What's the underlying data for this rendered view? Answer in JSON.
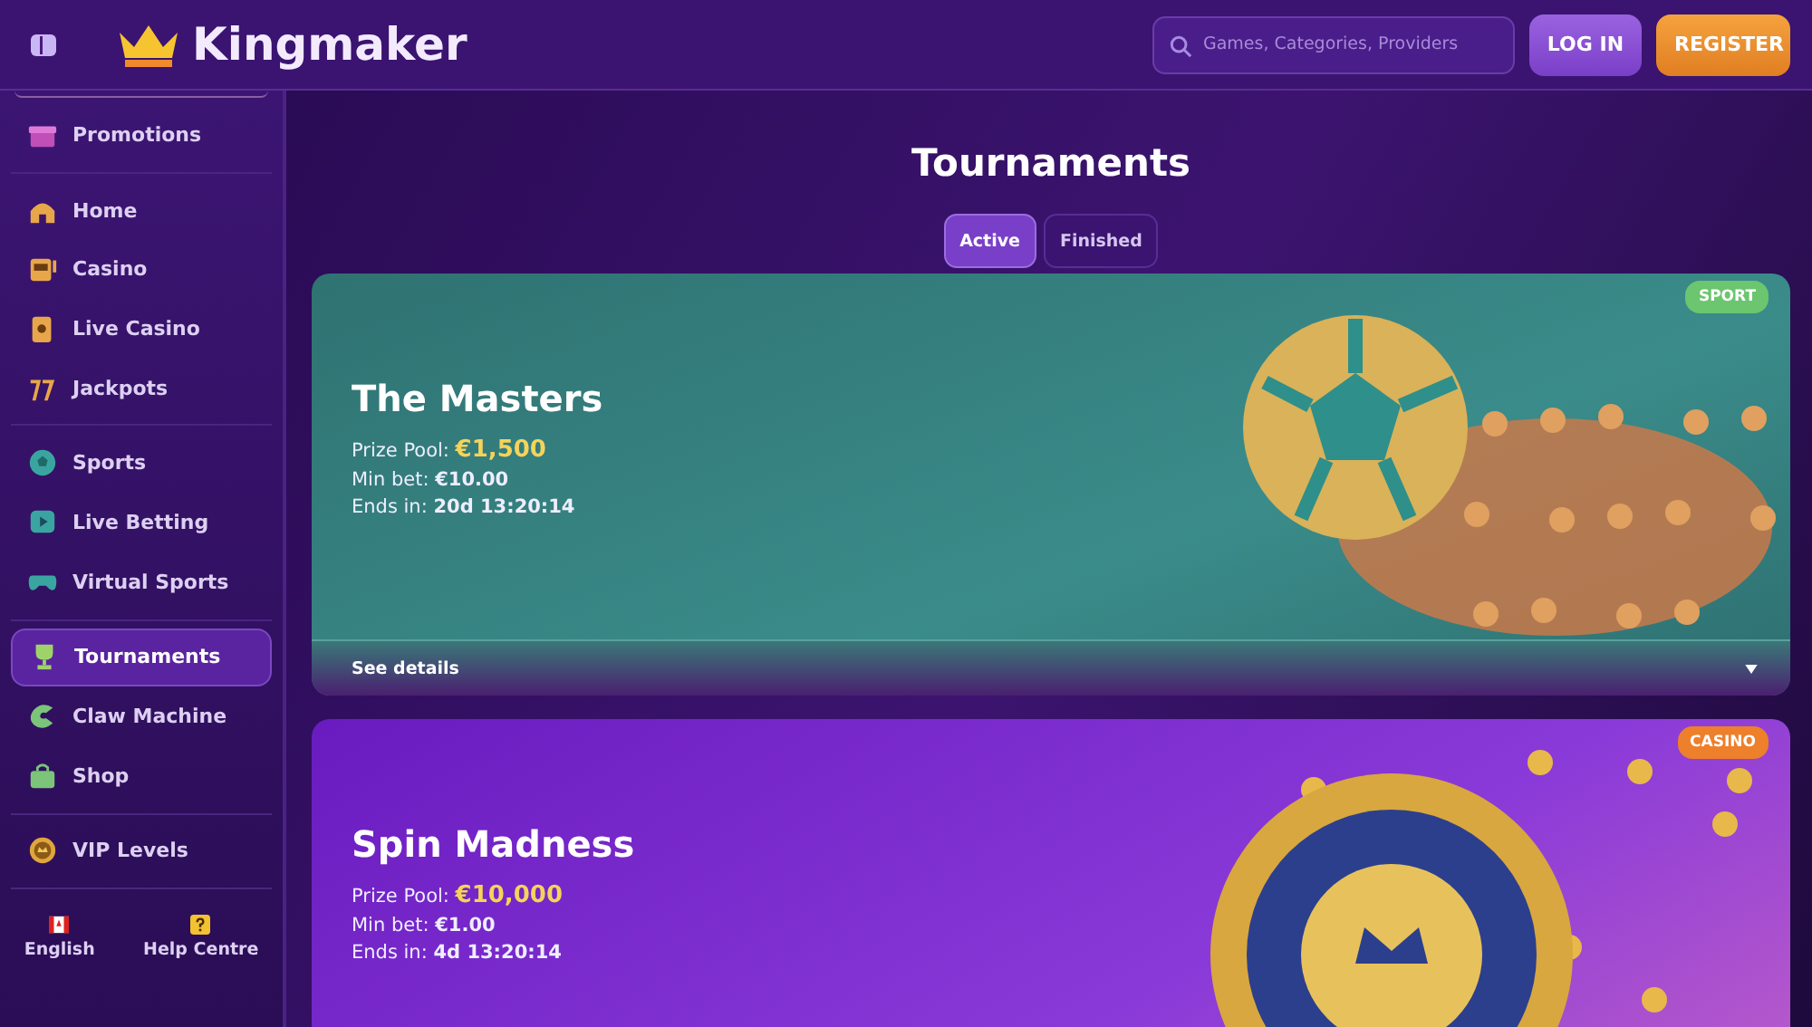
{
  "header": {
    "brand": "Kingmaker",
    "search": {
      "placeholder": "Games, Categories, Providers"
    },
    "buttons": [
      {
        "label": "LOG IN",
        "kind": "login"
      },
      {
        "label": "REGISTER",
        "kind": "register"
      }
    ]
  },
  "sidebar": {
    "groups": [
      {
        "items": [
          {
            "label": "Promotions",
            "selected": false
          }
        ]
      },
      {
        "items": [
          {
            "label": "Home",
            "selected": false
          },
          {
            "label": "Casino",
            "selected": false
          },
          {
            "label": "Live Casino",
            "selected": false
          },
          {
            "label": "Jackpots",
            "selected": false
          }
        ]
      },
      {
        "items": [
          {
            "label": "Sports",
            "selected": false
          },
          {
            "label": "Live Betting",
            "selected": false
          },
          {
            "label": "Virtual Sports",
            "selected": false
          }
        ]
      },
      {
        "items": [
          {
            "label": "Tournaments",
            "selected": true
          },
          {
            "label": "Claw Machine",
            "selected": false
          },
          {
            "label": "Shop",
            "selected": false
          }
        ]
      },
      {
        "items": [
          {
            "label": "VIP Levels",
            "selected": false
          }
        ]
      }
    ],
    "footer": [
      {
        "label": "English"
      },
      {
        "label": "Help Centre"
      }
    ]
  },
  "page": {
    "title": "Tournaments",
    "tabs": [
      {
        "label": "Active",
        "selected": true
      },
      {
        "label": "Finished",
        "selected": false
      }
    ],
    "cards": [
      {
        "kind": "sport",
        "badge": "SPORT",
        "color": "#6cc56f",
        "title": "The Masters",
        "prize_label": "Prize Pool:",
        "prize": "€1,500",
        "min_label": "Min bet:",
        "min": "€10.00",
        "ends_label": "Ends in:",
        "ends": "20d 13:20:14",
        "details": "See details"
      },
      {
        "kind": "casino",
        "badge": "CASINO",
        "color": "#ee7f2b",
        "title": "Spin Madness",
        "prize_label": "Prize Pool:",
        "prize": "€10,000",
        "min_label": "Min bet:",
        "min": "€1.00",
        "ends_label": "Ends in:",
        "ends": "4d 13:20:14"
      }
    ]
  }
}
